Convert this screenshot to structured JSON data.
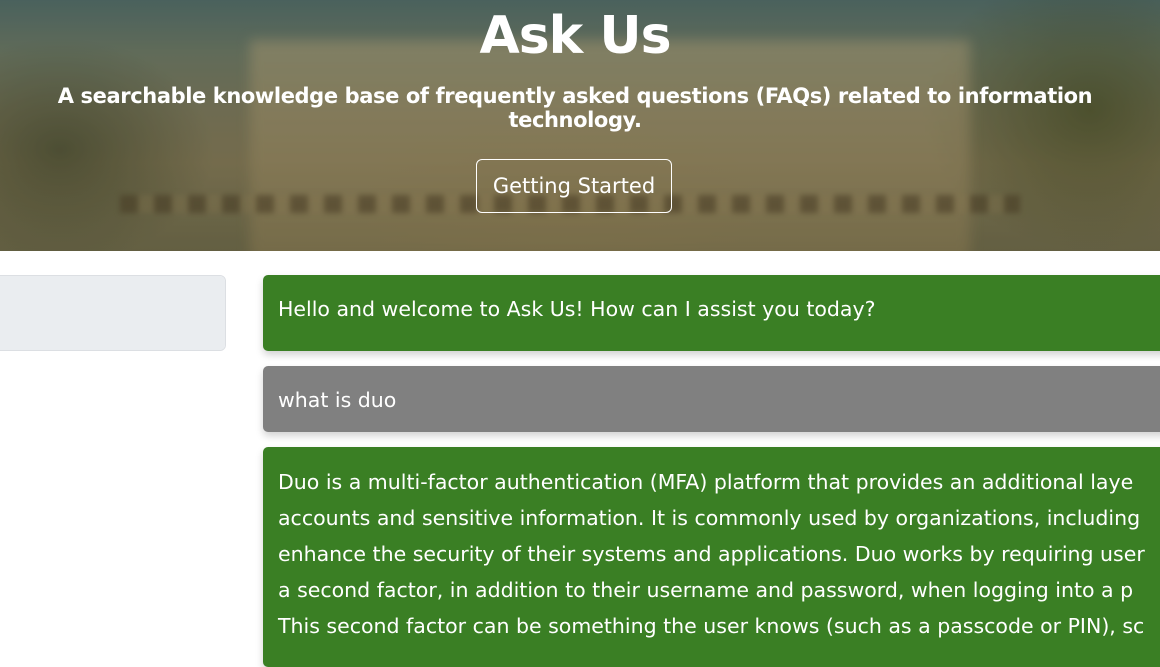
{
  "hero": {
    "title": "Ask Us",
    "subtitle": "A searchable knowledge base of frequently asked questions (FAQs) related to information technology.",
    "button_label": "Getting Started"
  },
  "search": {
    "placeholder": "",
    "icon": "search-icon"
  },
  "chat": {
    "messages": [
      {
        "role": "bot",
        "text": "Hello and welcome to Ask Us! How can I assist you today?"
      },
      {
        "role": "user",
        "text": "what is duo"
      },
      {
        "role": "bot",
        "lines": [
          "Duo is a multi-factor authentication (MFA) platform that provides an additional laye",
          "accounts and sensitive information. It is commonly used by organizations, including",
          "enhance the security of their systems and applications. Duo works by requiring user",
          "a second factor, in addition to their username and password, when logging into a p",
          "This second factor can be something the user knows (such as a passcode or PIN), sc"
        ]
      }
    ]
  },
  "colors": {
    "bot_bubble": "#3a7f24",
    "user_bubble": "#808080"
  }
}
